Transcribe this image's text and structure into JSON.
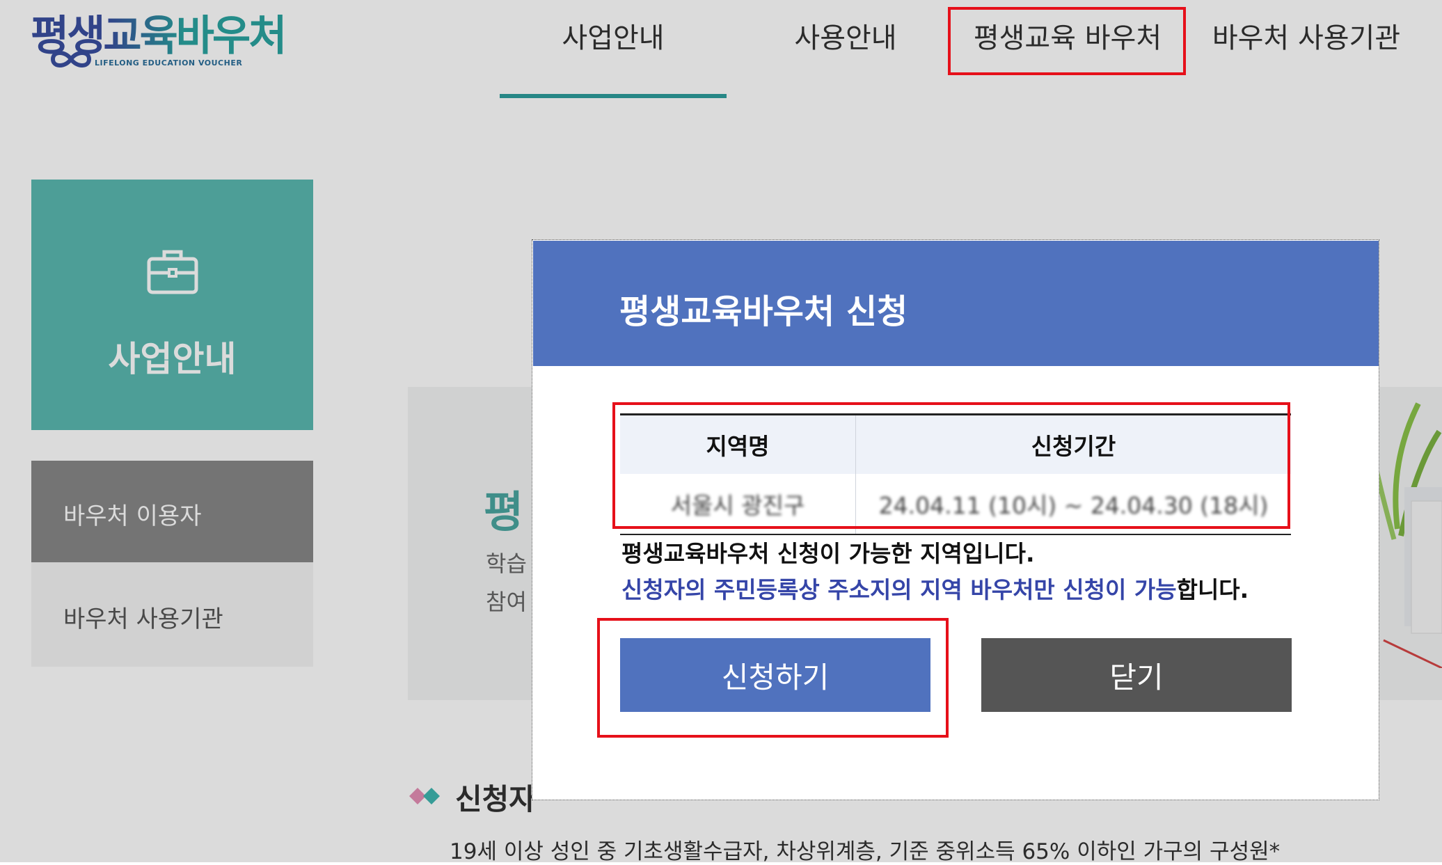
{
  "header": {
    "logo_text": "평생교육바우처",
    "logo_subtext": "LIFELONG EDUCATION VOUCHER",
    "nav": [
      {
        "label": "사업안내"
      },
      {
        "label": "사용안내"
      },
      {
        "label": "평생교육 바우처"
      },
      {
        "label": "바우처 사용기관"
      }
    ]
  },
  "sidebar": {
    "hero_label": "사업안내",
    "hero_icon": "briefcase-icon",
    "items": [
      {
        "label": "바우처 이용자"
      },
      {
        "label": "바우처 사용기관"
      }
    ]
  },
  "background": {
    "title_fragment": "평",
    "line1_fragment": "학습",
    "line2_fragment": "참여",
    "section_title": "신청자",
    "description": "19세 이상 성인 중 기초생활수급자, 차상위계층, 기준 중위소득 65% 이하인 가구의 구성원*"
  },
  "modal": {
    "title": "평생교육바우처 신청",
    "table": {
      "headers": [
        "지역명",
        "신청기간"
      ],
      "rows": [
        [
          "서울시 광진구",
          "24.04.11 (10시) ~ 24.04.30 (18시)"
        ]
      ]
    },
    "message_line1": "평생교육바우처 신청이 가능한 지역입니다.",
    "message_line2_highlight": "신청자의 주민등록상 주소지의 지역 바우처만 신청이 가능",
    "message_line2_rest": "합니다.",
    "apply_button": "신청하기",
    "close_button": "닫기"
  },
  "colors": {
    "primary_blue": "#5072be",
    "teal": "#5ab8b0",
    "dark_gray_button": "#555555",
    "highlight_red": "#e6101a",
    "highlight_text_blue": "#3545a8"
  }
}
